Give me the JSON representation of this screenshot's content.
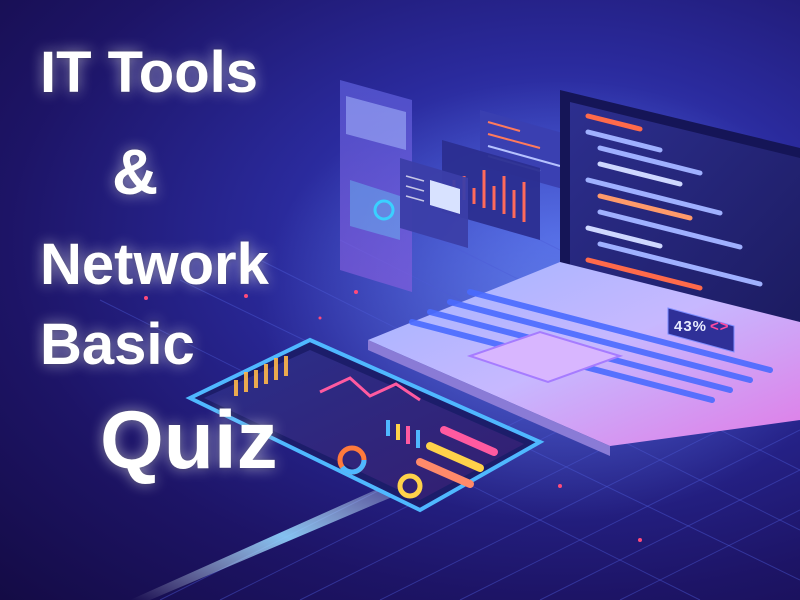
{
  "title": {
    "line1": "IT Tools",
    "line2": "&",
    "line3": "Network",
    "line4": "Basic",
    "line5": "Quiz"
  },
  "badge": {
    "percent": "43%",
    "arrows": "<>"
  },
  "colors": {
    "background_dark": "#140b45",
    "background_mid": "#2a2a9c",
    "accent_blue": "#4aa8ff",
    "accent_pink": "#ff4aa0",
    "accent_purple": "#a06bff",
    "accent_orange": "#ff7a3c"
  }
}
